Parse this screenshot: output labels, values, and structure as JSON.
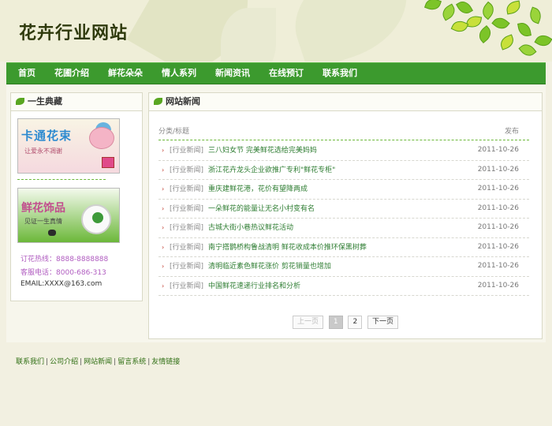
{
  "header": {
    "site_title": "花卉行业网站"
  },
  "nav": [
    "首页",
    "花圃介绍",
    "鲜花朵朵",
    "情人系列",
    "新闻资讯",
    "在线预订",
    "联系我们"
  ],
  "left_box": {
    "title": "一生典藏",
    "banner1": {
      "title": "卡通花束",
      "subtitle": "让爱永不凋谢"
    },
    "banner2": {
      "title": "鲜花饰品",
      "subtitle": "见证一生真情"
    },
    "order_hotline": {
      "label": "订花热线：",
      "value": "8888-8888888"
    },
    "service_phone": {
      "label": "客服电话：",
      "value": "8000-686-313"
    },
    "email": "EMAIL:XXXX@163.com"
  },
  "news_box": {
    "title": "网站新闻",
    "col_category_title": "分类/标题",
    "col_published": "发布",
    "items": [
      {
        "category": "[行业新闻]",
        "title": "三八妇女节 完美鲜花选给完美妈妈",
        "date": "2011-10-26"
      },
      {
        "category": "[行业新闻]",
        "title": "浙江花卉龙头企业欲推广专利\"鲜花专柜\"",
        "date": "2011-10-26"
      },
      {
        "category": "[行业新闻]",
        "title": "重庆建鲜花港，花价有望降两成",
        "date": "2011-10-26"
      },
      {
        "category": "[行业新闻]",
        "title": "一朵鲜花的能量让无名小村变有名",
        "date": "2011-10-26"
      },
      {
        "category": "[行业新闻]",
        "title": "古城大街小巷热议鲜花活动",
        "date": "2011-10-26"
      },
      {
        "category": "[行业新闻]",
        "title": "南宁搭鹊桥构鲁战清明 鲜花收成本价推环保黑树葬",
        "date": "2011-10-26"
      },
      {
        "category": "[行业新闻]",
        "title": "清明临近素色鲜花涨价 剪花销量也增加",
        "date": "2011-10-26"
      },
      {
        "category": "[行业新闻]",
        "title": "中国鲜花速递行业排名和分析",
        "date": "2011-10-26"
      }
    ],
    "pager": {
      "prev": "上一页",
      "pages": [
        "1",
        "2"
      ],
      "current": "1",
      "next": "下一页"
    }
  },
  "footer": [
    "联系我们",
    "公司介绍",
    "网站新闻",
    "留言系统",
    "友情链接"
  ],
  "colors": {
    "nav_green": "#3c9a2e",
    "link_green": "#2e7d32",
    "accent_pink": "#b05cc0"
  }
}
